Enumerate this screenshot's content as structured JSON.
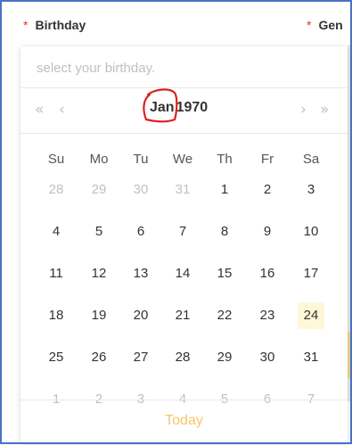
{
  "form": {
    "birthday_label": "Birthday",
    "gender_label": "Gen",
    "required_mark": "*"
  },
  "picker": {
    "placeholder": "select your birthday.",
    "value": "",
    "nav": {
      "prev_year": "«",
      "prev_month": "‹",
      "next_month": "›",
      "next_year": "»"
    },
    "month": "Jan",
    "year": "1970",
    "weekdays": [
      "Su",
      "Mo",
      "Tu",
      "We",
      "Th",
      "Fr",
      "Sa"
    ],
    "weeks": [
      [
        {
          "d": "28",
          "muted": true
        },
        {
          "d": "29",
          "muted": true
        },
        {
          "d": "30",
          "muted": true
        },
        {
          "d": "31",
          "muted": true
        },
        {
          "d": "1"
        },
        {
          "d": "2"
        },
        {
          "d": "3"
        }
      ],
      [
        {
          "d": "4"
        },
        {
          "d": "5"
        },
        {
          "d": "6"
        },
        {
          "d": "7"
        },
        {
          "d": "8"
        },
        {
          "d": "9"
        },
        {
          "d": "10"
        }
      ],
      [
        {
          "d": "11"
        },
        {
          "d": "12"
        },
        {
          "d": "13"
        },
        {
          "d": "14"
        },
        {
          "d": "15"
        },
        {
          "d": "16"
        },
        {
          "d": "17"
        }
      ],
      [
        {
          "d": "18"
        },
        {
          "d": "19"
        },
        {
          "d": "20"
        },
        {
          "d": "21"
        },
        {
          "d": "22"
        },
        {
          "d": "23"
        },
        {
          "d": "24",
          "today": true
        }
      ],
      [
        {
          "d": "25"
        },
        {
          "d": "26"
        },
        {
          "d": "27"
        },
        {
          "d": "28"
        },
        {
          "d": "29"
        },
        {
          "d": "30"
        },
        {
          "d": "31"
        }
      ],
      [
        {
          "d": "1",
          "muted": true
        },
        {
          "d": "2",
          "muted": true
        },
        {
          "d": "3",
          "muted": true
        },
        {
          "d": "4",
          "muted": true
        },
        {
          "d": "5",
          "muted": true
        },
        {
          "d": "6",
          "muted": true
        },
        {
          "d": "7",
          "muted": true
        }
      ]
    ],
    "today_label": "Today"
  },
  "colors": {
    "required": "#e5322d",
    "today_link": "#f4c76a",
    "today_highlight": "#fff8d8",
    "annotation": "#e0201c",
    "frame": "#4a72c4"
  }
}
